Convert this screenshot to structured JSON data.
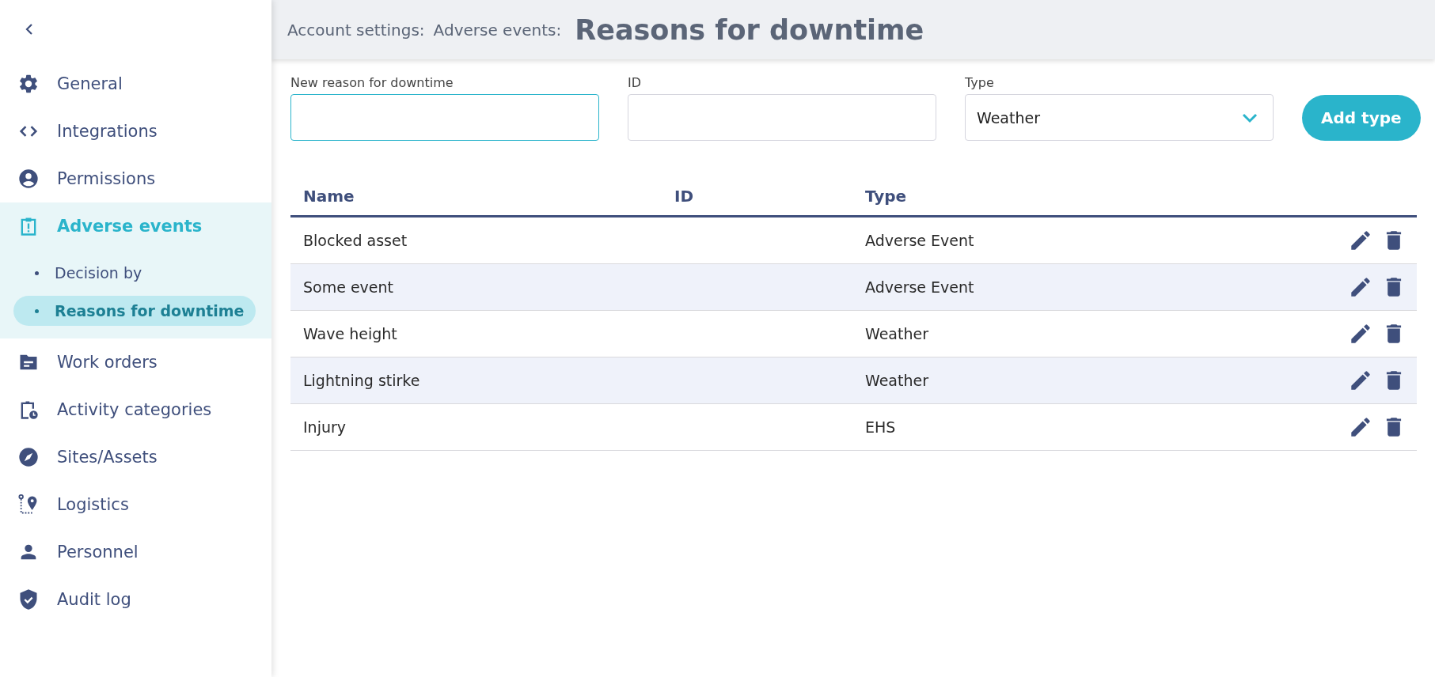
{
  "sidebar": {
    "items": [
      {
        "label": "General",
        "selected": false
      },
      {
        "label": "Integrations",
        "selected": false
      },
      {
        "label": "Permissions",
        "selected": false
      },
      {
        "label": "Adverse events",
        "selected": true,
        "children": [
          {
            "label": "Decision by",
            "selected": false
          },
          {
            "label": "Reasons for downtime",
            "selected": true
          }
        ]
      },
      {
        "label": "Work orders",
        "selected": false
      },
      {
        "label": "Activity categories",
        "selected": false
      },
      {
        "label": "Sites/Assets",
        "selected": false
      },
      {
        "label": "Logistics",
        "selected": false
      },
      {
        "label": "Personnel",
        "selected": false
      },
      {
        "label": "Audit log",
        "selected": false
      }
    ]
  },
  "header": {
    "breadcrumbs": [
      "Account settings:",
      "Adverse events:"
    ],
    "title": "Reasons for downtime"
  },
  "form": {
    "fields": [
      {
        "label": "New reason for downtime",
        "focused": true
      },
      {
        "label": "ID",
        "focused": false
      }
    ],
    "type_select": {
      "label": "Type",
      "value": "Weather"
    },
    "add_button": "Add type"
  },
  "table": {
    "columns": [
      "Name",
      "ID",
      "Type"
    ],
    "rows": [
      {
        "name": "Blocked asset",
        "type": "Adverse Event"
      },
      {
        "name": "Some event",
        "type": "Adverse Event"
      },
      {
        "name": "Wave height",
        "type": "Weather"
      },
      {
        "name": "Lightning stirke",
        "type": "Weather"
      },
      {
        "name": "Injury",
        "type": "EHS"
      }
    ]
  }
}
